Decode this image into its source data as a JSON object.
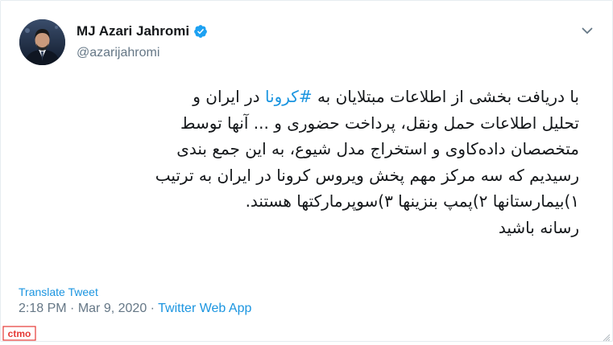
{
  "tweet": {
    "author": {
      "display_name": "MJ Azari Jahromi",
      "handle": "@azarijahromi",
      "verified": true,
      "avatar_icon": "profile-photo"
    },
    "text_lines": [
      {
        "before": "با دریافت بخشی از اطلاعات مبتلایان به ",
        "hashtag": "#کرونا",
        "after": " در ایران و"
      },
      {
        "text": "تحلیل اطلاعات حمل ونقل، پرداخت حضوری و ... آنها توسط"
      },
      {
        "text": "متخصصان داده‌کاوی و استخراج مدل شیوع، به این جمع بندی"
      },
      {
        "text": "رسیدیم که سه مرکز مهم پخش ویروس کرونا در ایران به ترتیب"
      },
      {
        "text": "۱)بیمارستانها ۲)پمپ بنزینها ۳)سوپرمارکتها هستند."
      },
      {
        "text": "رسانه باشید"
      }
    ],
    "translate_label": "Translate Tweet",
    "time": "2:18 PM",
    "date": "Mar 9, 2020",
    "separator": "·",
    "source_app": "Twitter Web App",
    "menu_icon": "chevron-down-icon"
  },
  "watermark": {
    "text": "ctmo",
    "color": "#e53935"
  },
  "colors": {
    "link": "#1b95e0",
    "muted": "#657786",
    "text": "#14171a",
    "verified": "#1da1f2"
  }
}
